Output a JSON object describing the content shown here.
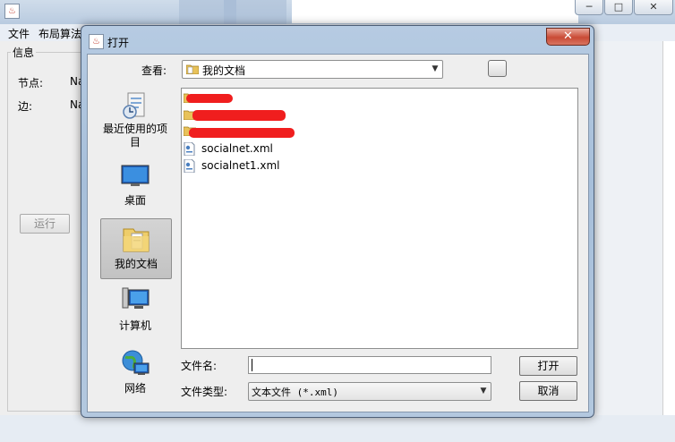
{
  "background_window": {
    "menu": [
      "文件",
      "布局算法"
    ],
    "window_buttons": [
      "─",
      "□",
      "✕"
    ],
    "info_panel": {
      "title": "信息",
      "node_label": "节点:",
      "node_value": "Na",
      "edge_label": "边:",
      "edge_value": "Na",
      "run_button": "运行"
    }
  },
  "dialog": {
    "title": "打开",
    "close_label": "✕",
    "look_in": {
      "label": "查看:",
      "value": "我的文档"
    },
    "places": [
      {
        "icon": "recent-items-icon",
        "label": "最近使用的项目"
      },
      {
        "icon": "desktop-icon",
        "label": "桌面"
      },
      {
        "icon": "documents-folder-icon",
        "label": "我的文档",
        "selected": true
      },
      {
        "icon": "computer-icon",
        "label": "计算机"
      },
      {
        "icon": "network-icon",
        "label": "网络"
      }
    ],
    "files": [
      {
        "type": "folder",
        "name": ""
      },
      {
        "type": "folder",
        "name": ""
      },
      {
        "type": "folder",
        "name": ""
      },
      {
        "type": "xml-file",
        "name": "socialnet.xml"
      },
      {
        "type": "xml-file",
        "name": "socialnet1.xml"
      }
    ],
    "file_name": {
      "label": "文件名:",
      "value": ""
    },
    "file_type": {
      "label": "文件类型:",
      "value": "文本文件 (*.xml)"
    },
    "open_button": "打开",
    "cancel_button": "取消"
  }
}
